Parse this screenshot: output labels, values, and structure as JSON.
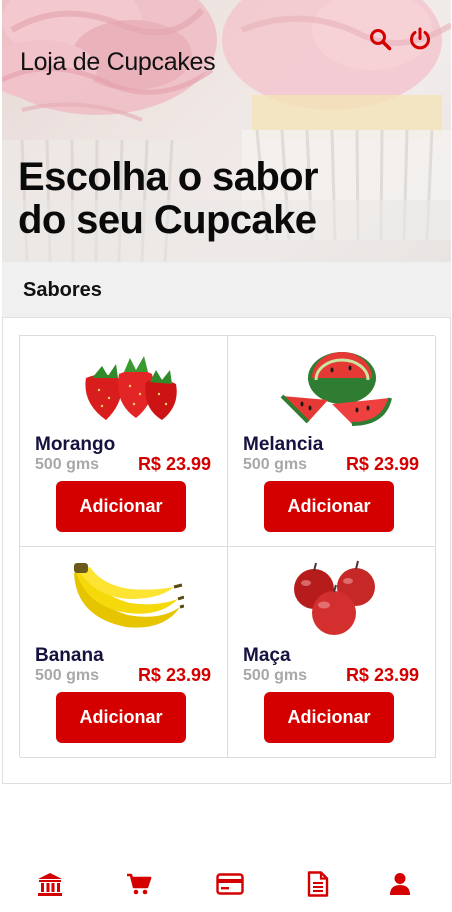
{
  "app": {
    "title": "Loja de Cupcakes",
    "headline_line1": "Escolha o sabor",
    "headline_line2": "do seu Cupcake"
  },
  "header_actions": [
    {
      "icon": "search-icon"
    },
    {
      "icon": "power-icon"
    }
  ],
  "section": {
    "title": "Sabores"
  },
  "products": [
    {
      "name": "Morango",
      "weight": "500 gms",
      "price": "R$ 23.99",
      "button": "Adicionar",
      "image": "strawberry"
    },
    {
      "name": "Melancia",
      "weight": "500 gms",
      "price": "R$ 23.99",
      "button": "Adicionar",
      "image": "watermelon"
    },
    {
      "name": "Banana",
      "weight": "500 gms",
      "price": "R$ 23.99",
      "button": "Adicionar",
      "image": "banana"
    },
    {
      "name": "Maça",
      "weight": "500 gms",
      "price": "R$ 23.99",
      "button": "Adicionar",
      "image": "apple"
    }
  ],
  "bottom_nav": [
    {
      "icon": "bank-icon"
    },
    {
      "icon": "cart-icon"
    },
    {
      "icon": "credit-card-icon"
    },
    {
      "icon": "document-icon"
    },
    {
      "icon": "user-icon"
    }
  ],
  "colors": {
    "accent": "#d40000",
    "product_name": "#14133f",
    "weight_text": "#a8a8a8",
    "section_bg": "#f0f0f0"
  }
}
